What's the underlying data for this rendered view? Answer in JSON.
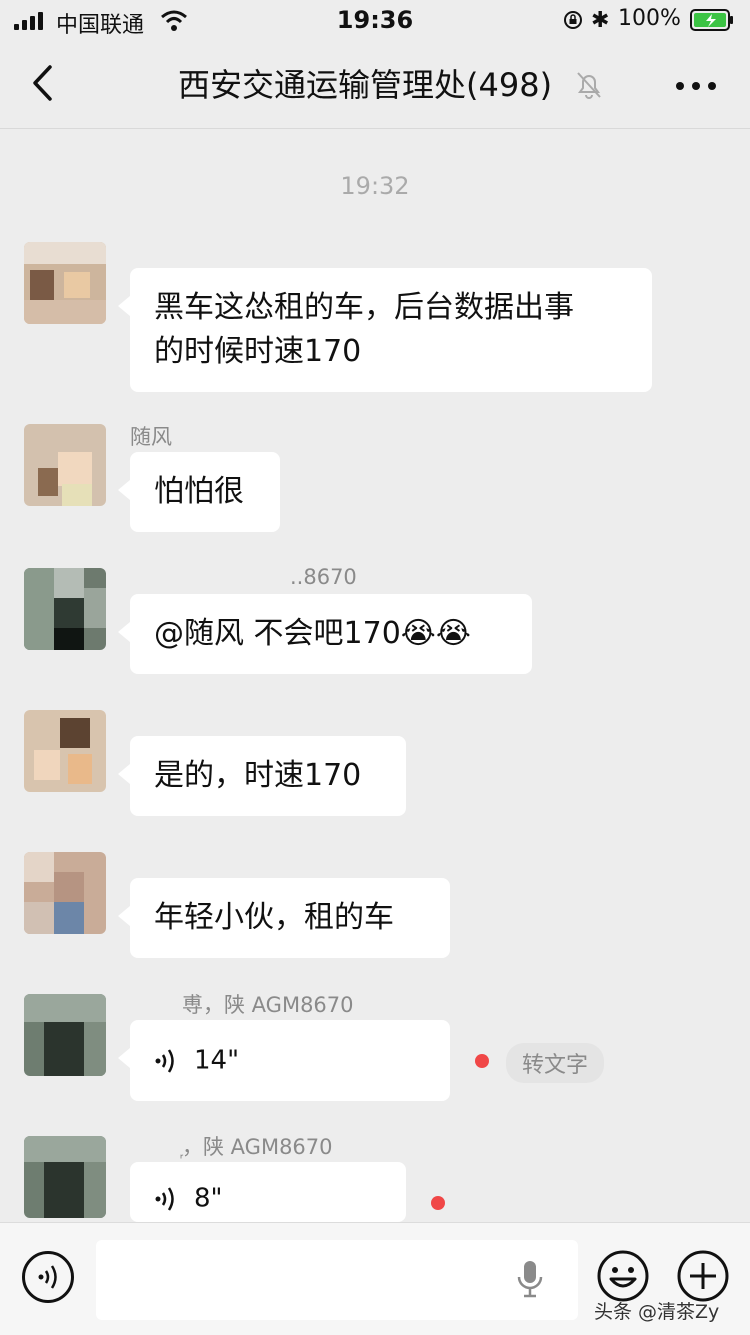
{
  "status_bar": {
    "carrier": "中国联通",
    "time": "19:36",
    "battery": "100%"
  },
  "header": {
    "title": "西安交通运输管理处(498)"
  },
  "chat": {
    "timestamp": "19:32",
    "messages": [
      {
        "sender": "",
        "text_line1": "黑车这怂租的车，后台数据出事",
        "text_line2": "的时候时速170"
      },
      {
        "sender": "随风",
        "text": "怕怕很"
      },
      {
        "sender": "..8670",
        "text": "@随风 不会吧170",
        "emoji": "😭😭"
      },
      {
        "sender": "",
        "text": "是的，时速170"
      },
      {
        "sender": "",
        "text": "年轻小伙，租的车"
      },
      {
        "sender": "尃，陕 AGM8670",
        "voice_duration": "14\"",
        "to_text_label": "转文字"
      },
      {
        "sender": "᷊，陕 AGM8670",
        "voice_duration": "8\""
      }
    ]
  },
  "input_bar": {
    "placeholder": ""
  },
  "watermark": "头条 @清茶Zy",
  "colors": {
    "background": "#ededed",
    "bubble": "#ffffff",
    "unread_dot": "#f04747",
    "battery_green": "#3cc444"
  },
  "icons": [
    "back-icon",
    "mute-bell-icon",
    "more-icon",
    "voice-wave-icon",
    "microphone-icon",
    "emoji-icon",
    "plus-icon",
    "voice-input-icon"
  ]
}
